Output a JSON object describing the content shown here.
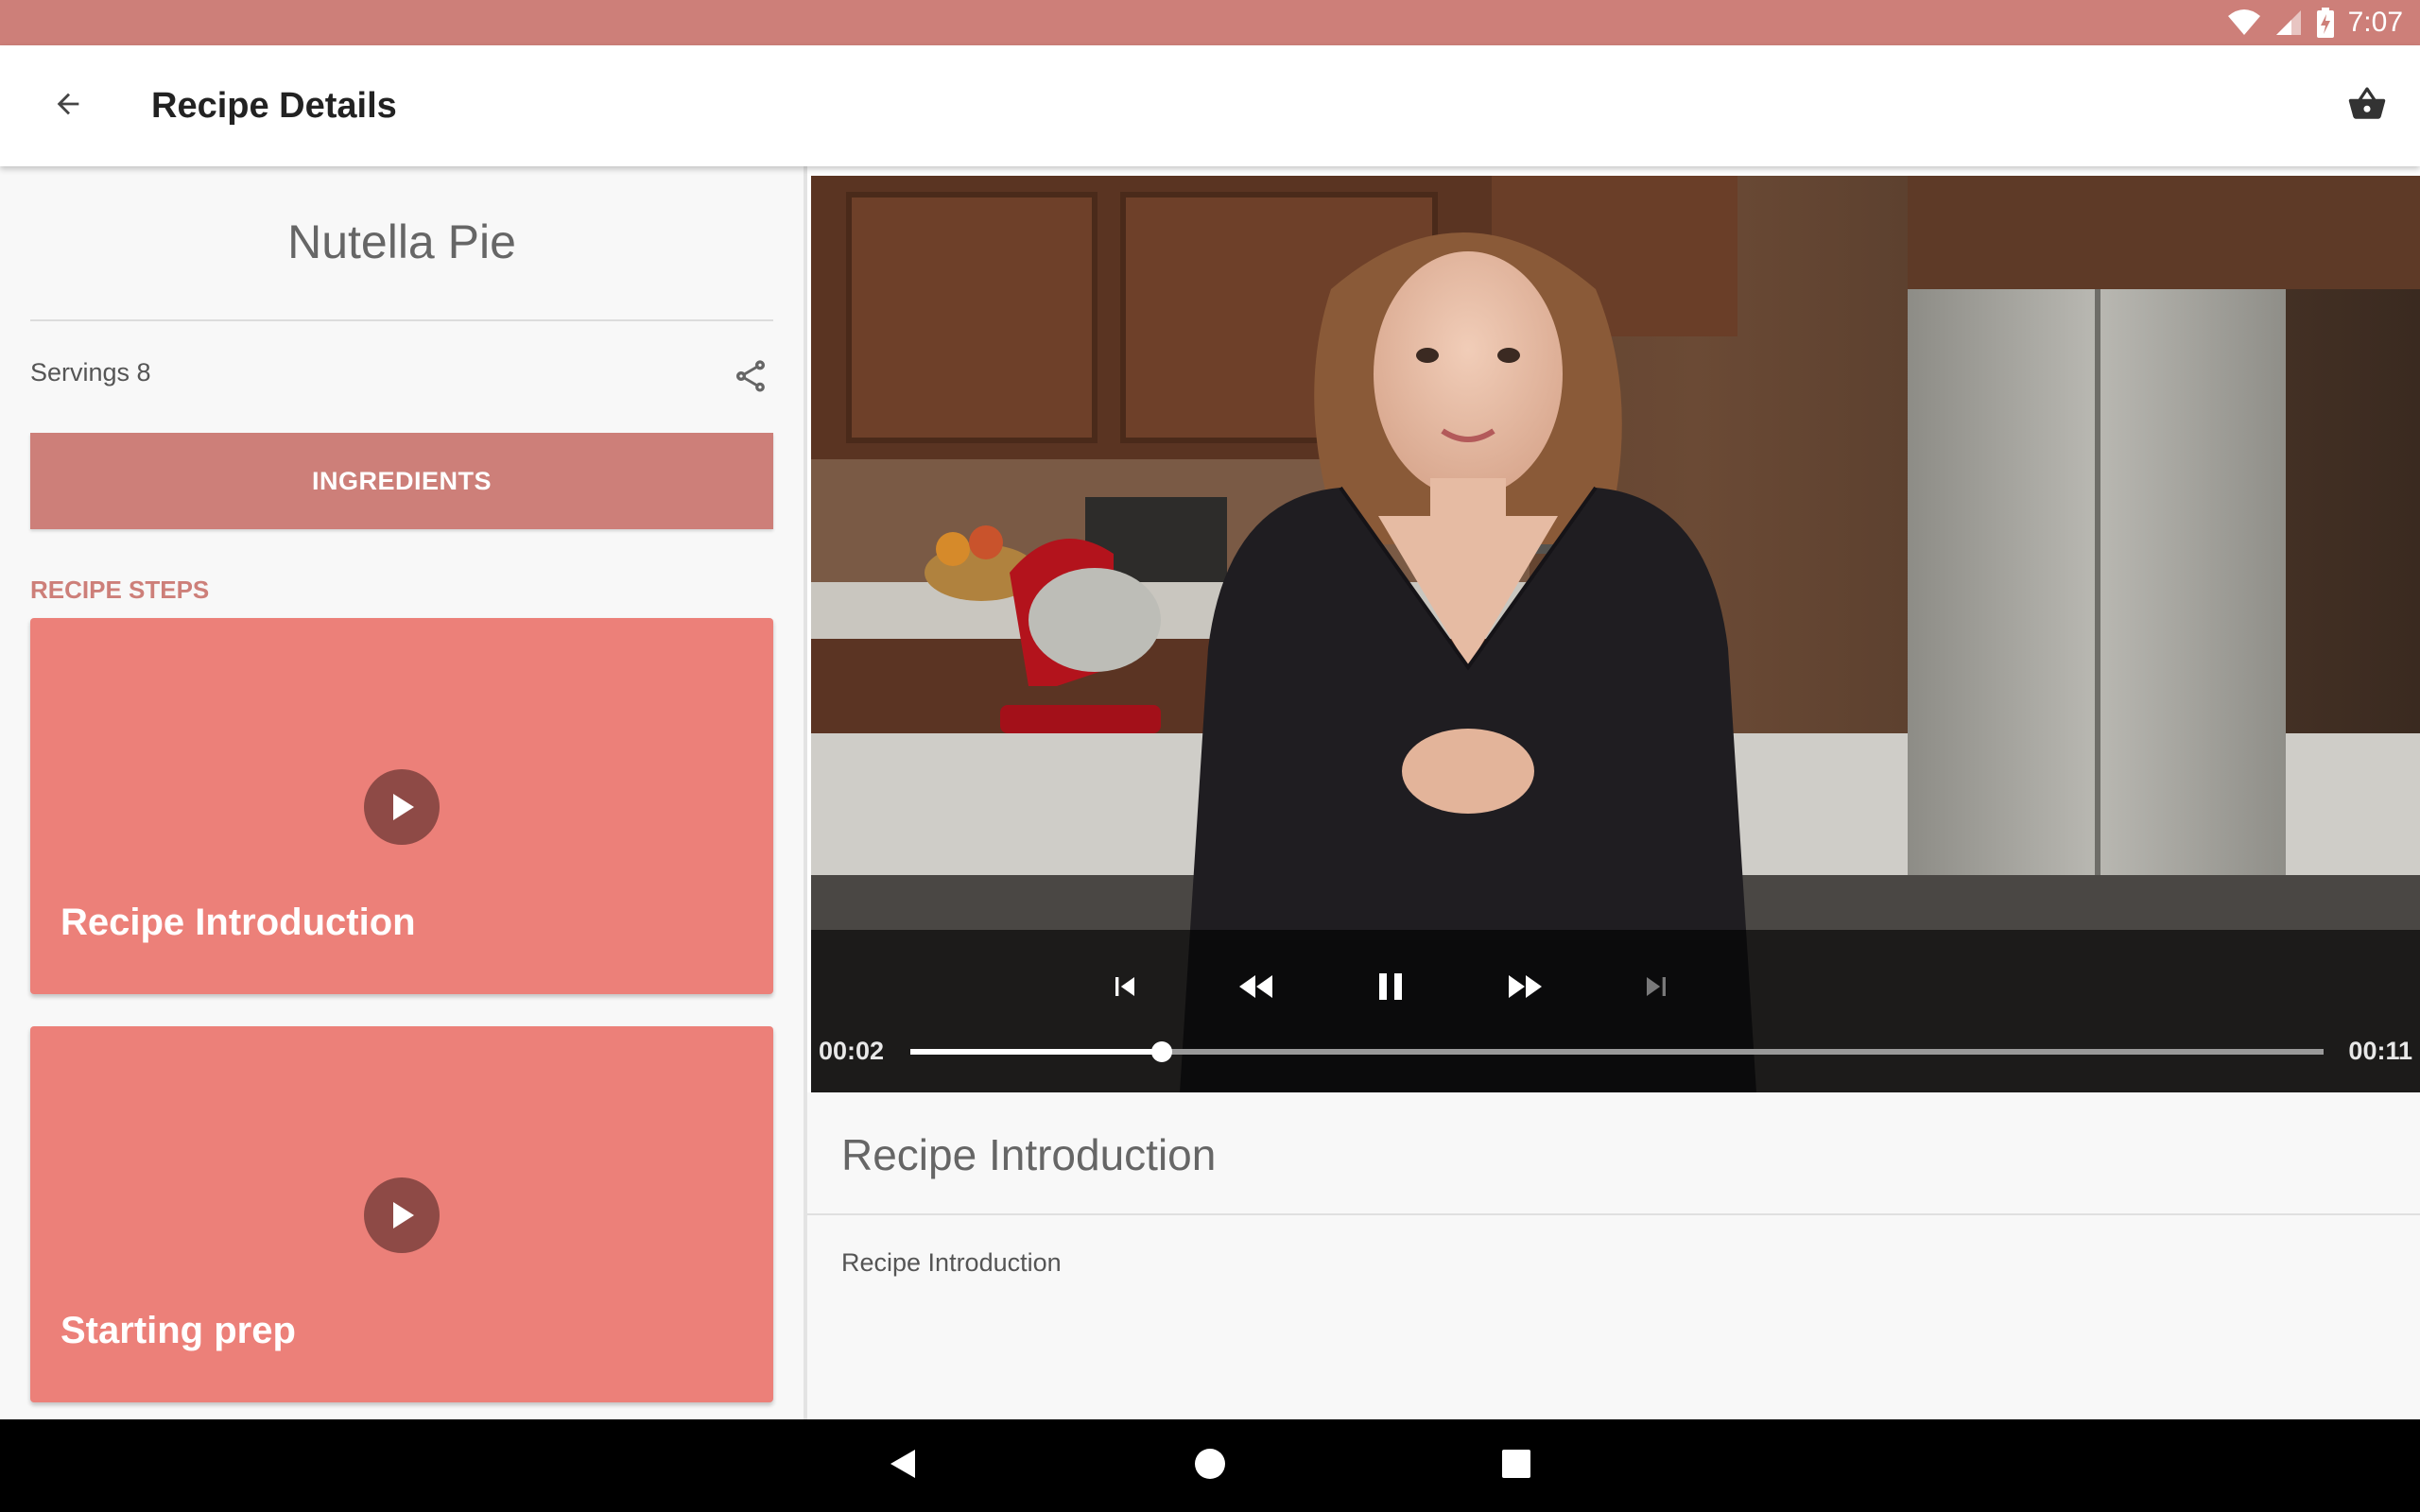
{
  "status_bar": {
    "time": "7:07",
    "icons": [
      "wifi-icon",
      "signal-icon",
      "battery-charging-icon"
    ]
  },
  "app_bar": {
    "title": "Recipe Details",
    "back_icon": "arrow-back-icon",
    "cart_icon": "shopping-basket-icon"
  },
  "recipe": {
    "name": "Nutella Pie",
    "servings_label": "Servings 8",
    "share_icon": "share-icon",
    "ingredients_button": "INGREDIENTS",
    "steps_header": "RECIPE STEPS",
    "steps": [
      {
        "title": "Recipe Introduction"
      },
      {
        "title": "Starting prep"
      }
    ]
  },
  "player": {
    "current_time": "00:02",
    "duration": "00:11",
    "progress": 0.178,
    "controls": [
      "skip-previous-icon",
      "rewind-icon",
      "pause-icon",
      "fast-forward-icon",
      "skip-next-icon"
    ],
    "skip_next_enabled": false
  },
  "step_detail": {
    "title": "Recipe Introduction",
    "description": "Recipe Introduction"
  },
  "nav_bar": {
    "buttons": [
      "nav-back-icon",
      "nav-home-icon",
      "nav-recents-icon"
    ]
  },
  "colors": {
    "primary": "#cd7f79",
    "card": "#ec8079",
    "play_circle": "#8e4a46",
    "background": "#f8f8f8"
  }
}
